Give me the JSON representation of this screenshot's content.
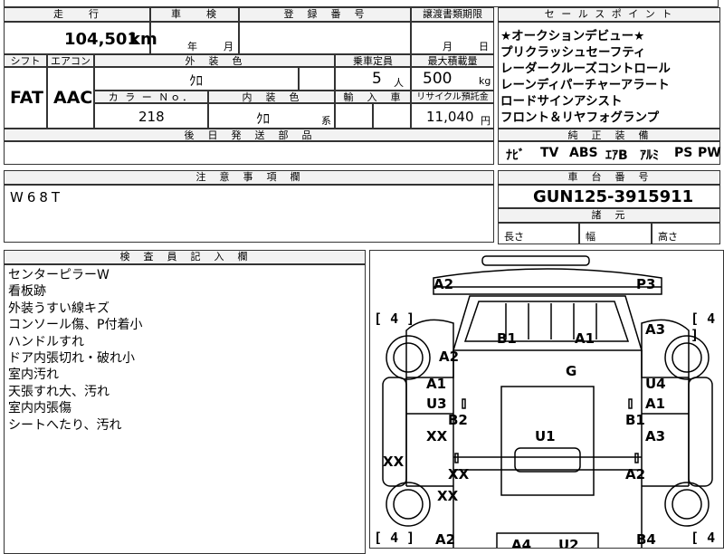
{
  "top": {
    "mileage_header": "走　　行",
    "mileage_value": "104,501",
    "mileage_unit": "km",
    "inspection_header": "車　　検",
    "inspection_year_unit": "年",
    "inspection_month_unit": "月",
    "reg_header": "登　録　番　号",
    "transfer_header": "譲渡書類期限",
    "transfer_month_unit": "月",
    "transfer_day_unit": "日"
  },
  "specs": {
    "shift_header": "シフト",
    "aircon_header": "エアコン",
    "ext_color_header": "外　装　色",
    "capacity_header": "乗車定員",
    "maxload_header": "最大積載量",
    "shift_value": "FAT",
    "aircon_value": "AAC",
    "ext_color_value": "ｸﾛ",
    "capacity_value": "5",
    "capacity_unit": "人",
    "maxload_value": "500",
    "maxload_unit": "kg",
    "colorno_header": "カ ラ ー Ｎｏ．",
    "int_color_header": "内　装　色",
    "import_header": "輸　入　車",
    "recycle_header": "リサイクル預託金",
    "colorno_value": "218",
    "int_color_value": "ｸﾛ",
    "int_color_suffix": "系",
    "recycle_value": "11,040",
    "recycle_unit": "円",
    "later_parts_header": "後　日　発　送　部　品"
  },
  "sales": {
    "header": "セ ー ル ス ポ イ ン ト",
    "points": [
      "★オークションデビュー★",
      "プリクラッシュセーフティ",
      "レーダークルーズコントロール",
      "レーンディパーチャーアラート",
      "ロードサインアシスト",
      "フロント＆リヤフォグランプ"
    ],
    "equip_header": "純　正　装　備",
    "equipment": [
      "ﾅﾋﾞ",
      "TV",
      "ABS",
      "ｴｱB",
      "ｱﾙﾐ",
      "PS",
      "PW"
    ]
  },
  "notes": {
    "header": "注　意　事　項　欄",
    "text": "W68T"
  },
  "chassis": {
    "header": "車　台　番　号",
    "value": "GUN125-3915911",
    "dims_header": "諸　元",
    "length_label": "長さ",
    "width_label": "幅",
    "height_label": "高さ"
  },
  "inspector": {
    "header": "検　査　員　記　入　欄",
    "lines": [
      "センターピラーW",
      "看板跡",
      "外装うすい線キズ",
      "コンソール傷、P付着小",
      "ハンドルすれ",
      "ドア内張切れ・破れ小",
      "室内汚れ",
      "天張すれ大、汚れ",
      "室内内張傷",
      "シートへたり、汚れ"
    ]
  },
  "diagram": {
    "marks": [
      "A2",
      "P3",
      "B1",
      "A1",
      "A2",
      "A3",
      "G",
      "A1",
      "U4",
      "U3",
      "A1",
      "B2",
      "B1",
      "XX",
      "U1",
      "A3",
      "XX",
      "XX",
      "A2",
      "XX",
      "A2",
      "A4",
      "U2",
      "B4"
    ],
    "tire_marks": [
      "4",
      "4",
      "4",
      "4"
    ]
  }
}
